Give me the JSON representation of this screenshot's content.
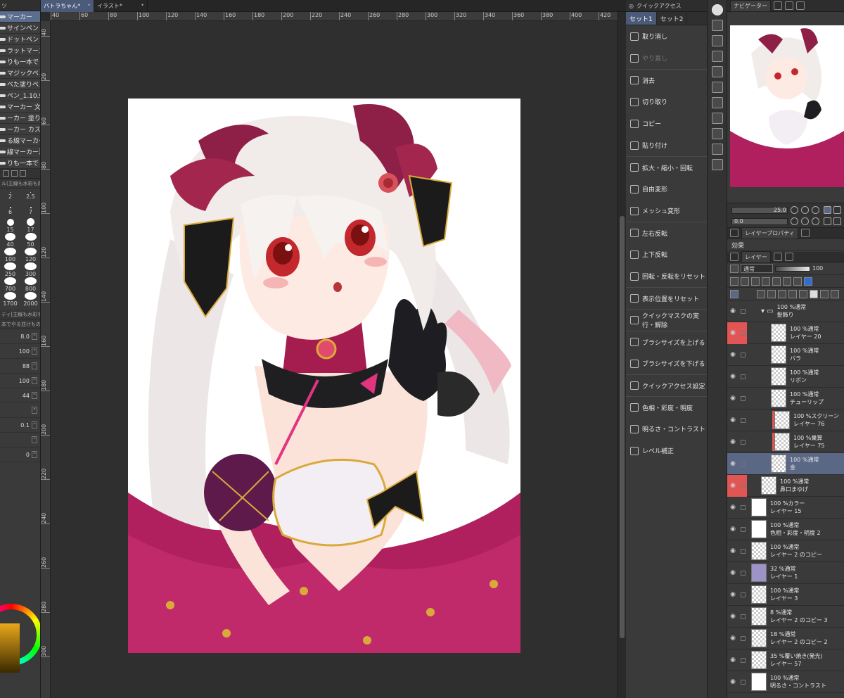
{
  "left_panel": {
    "header": "ツ",
    "subtools": [
      {
        "label": "マーカー",
        "selected": true
      },
      {
        "label": "サインペン",
        "selected": false
      },
      {
        "label": "ドットペン",
        "selected": false
      },
      {
        "label": "ラットマーカー",
        "selected": false
      },
      {
        "label": "りも一本で",
        "selected": false
      },
      {
        "label": "マジックペン",
        "selected": false
      },
      {
        "label": "べた塗りペン",
        "selected": false
      },
      {
        "label": "ペン_1.10.9",
        "selected": false
      },
      {
        "label": "マーカー 文字用",
        "selected": false
      },
      {
        "label": "ーカー 塗り用",
        "selected": false
      },
      {
        "label": "ーカー カスカス",
        "selected": false
      },
      {
        "label": "る線マーカー",
        "selected": false
      },
      {
        "label": "線マーカー濃",
        "selected": false
      },
      {
        "label": "りも一本で",
        "selected": false
      }
    ],
    "brush_section_title": "ル(主線も水彩も厚",
    "brush_sizes": [
      "2",
      "2.5",
      "6",
      "7",
      "15",
      "17",
      "40",
      "50",
      "100",
      "120",
      "250",
      "300",
      "700",
      "800",
      "1700",
      "2000"
    ],
    "tool_property_title": "ティ[主線も水彩も厚",
    "tool_property_sub": "本でやる並けものブ",
    "property_values": [
      "8.0",
      "100",
      "88",
      "100",
      "44",
      "",
      "0.1",
      "",
      "0"
    ]
  },
  "document_tabs": [
    {
      "label": "バトラちゃん*",
      "active": true
    },
    {
      "label": "イラスト*",
      "active": false
    }
  ],
  "ruler_h": [
    "40",
    "60",
    "80",
    "100",
    "120",
    "140",
    "160",
    "180",
    "200",
    "220",
    "240",
    "260",
    "280",
    "300",
    "320",
    "340",
    "360",
    "380",
    "400",
    "420"
  ],
  "ruler_v": [
    "40",
    "20",
    "60",
    "80",
    "100",
    "120",
    "140",
    "160",
    "180",
    "200",
    "220",
    "240",
    "260",
    "280",
    "300"
  ],
  "quick_access": {
    "title": "クイックアクセス",
    "tabs": [
      {
        "label": "セット1",
        "active": true
      },
      {
        "label": "セット2",
        "active": false
      }
    ],
    "items": [
      {
        "label": "取り消し",
        "icon": "undo-icon",
        "dim": false,
        "sep": false
      },
      {
        "label": "やり直し",
        "icon": "redo-icon",
        "dim": true,
        "sep": false
      },
      {
        "label": "消去",
        "icon": "clear-icon",
        "dim": false,
        "sep": true
      },
      {
        "label": "切り取り",
        "icon": "cut-icon",
        "dim": false,
        "sep": false
      },
      {
        "label": "コピー",
        "icon": "copy-icon",
        "dim": false,
        "sep": false
      },
      {
        "label": "貼り付け",
        "icon": "paste-icon",
        "dim": false,
        "sep": false
      },
      {
        "label": "拡大・縮小・回転",
        "icon": "transform-icon",
        "dim": false,
        "sep": true
      },
      {
        "label": "自由変形",
        "icon": "free-transform-icon",
        "dim": false,
        "sep": false
      },
      {
        "label": "メッシュ変形",
        "icon": "mesh-icon",
        "dim": false,
        "sep": false
      },
      {
        "label": "左右反転",
        "icon": "flip-h-icon",
        "dim": false,
        "sep": true
      },
      {
        "label": "上下反転",
        "icon": "flip-v-icon",
        "dim": false,
        "sep": false
      },
      {
        "label": "回転・反転をリセット",
        "icon": "reset-rotate-icon",
        "dim": false,
        "sep": false
      },
      {
        "label": "表示位置をリセット",
        "icon": "reset-view-icon",
        "dim": false,
        "sep": true
      },
      {
        "label": "クイックマスクの実行・解除",
        "icon": "quickmask-icon",
        "dim": false,
        "sep": true
      },
      {
        "label": "ブラシサイズを上げる",
        "icon": "brush-up-icon",
        "dim": false,
        "sep": true
      },
      {
        "label": "ブラシサイズを下げる",
        "icon": "brush-down-icon",
        "dim": false,
        "sep": false
      },
      {
        "label": "クイックアクセス設定",
        "icon": "settings-icon",
        "dim": false,
        "sep": true
      },
      {
        "label": "色相・彩度・明度",
        "icon": "hue-icon",
        "dim": false,
        "sep": true
      },
      {
        "label": "明るさ・コントラスト",
        "icon": "brightness-icon",
        "dim": false,
        "sep": false
      },
      {
        "label": "レベル補正",
        "icon": "levels-icon",
        "dim": false,
        "sep": false
      }
    ]
  },
  "navigator": {
    "title": "ナビゲーター",
    "zoom": "25.0",
    "rotation": "0.0"
  },
  "layer_property": {
    "title": "レイヤープロパティ",
    "effect_label": "効果"
  },
  "layer_panel": {
    "title": "レイヤー",
    "blend_mode": "通常",
    "opacity": "100",
    "layers": [
      {
        "meta": "100 %通常",
        "name": "髪飾り",
        "thumb": "folder",
        "red": false,
        "sel": false,
        "clip": false,
        "indent": 1
      },
      {
        "meta": "100 %通常",
        "name": "レイヤー 20",
        "thumb": "check",
        "red": true,
        "sel": false,
        "clip": false,
        "indent": 2
      },
      {
        "meta": "100 %通常",
        "name": "バラ",
        "thumb": "check",
        "red": false,
        "sel": false,
        "clip": false,
        "indent": 2
      },
      {
        "meta": "100 %通常",
        "name": "リボン",
        "thumb": "check",
        "red": false,
        "sel": false,
        "clip": false,
        "indent": 2
      },
      {
        "meta": "100 %通常",
        "name": "チューリップ",
        "thumb": "check",
        "red": false,
        "sel": false,
        "clip": false,
        "indent": 2
      },
      {
        "meta": "100 %スクリーン",
        "name": "レイヤー 76",
        "thumb": "check",
        "red": false,
        "sel": false,
        "clip": true,
        "indent": 2
      },
      {
        "meta": "100 %乗算",
        "name": "レイヤー 75",
        "thumb": "check",
        "red": false,
        "sel": false,
        "clip": true,
        "indent": 2
      },
      {
        "meta": "100 %通常",
        "name": "金",
        "thumb": "check",
        "red": false,
        "sel": true,
        "clip": false,
        "indent": 2
      },
      {
        "meta": "100 %通常",
        "name": "鼻口まゆげ",
        "thumb": "check",
        "red": true,
        "sel": false,
        "clip": false,
        "indent": 1
      },
      {
        "meta": "100 %カラー",
        "name": "レイヤー 15",
        "thumb": "white",
        "red": false,
        "sel": false,
        "clip": false,
        "indent": 0
      },
      {
        "meta": "100 %通常",
        "name": "色相・彩度・明度 2",
        "thumb": "white",
        "red": false,
        "sel": false,
        "clip": false,
        "indent": 0
      },
      {
        "meta": "100 %通常",
        "name": "レイヤー 2 のコピー",
        "thumb": "check",
        "red": false,
        "sel": false,
        "clip": false,
        "indent": 0
      },
      {
        "meta": "32 %通常",
        "name": "レイヤー 1",
        "thumb": "purple",
        "red": false,
        "sel": false,
        "clip": false,
        "indent": 0
      },
      {
        "meta": "100 %通常",
        "name": "レイヤー 3",
        "thumb": "check",
        "red": false,
        "sel": false,
        "clip": false,
        "indent": 0
      },
      {
        "meta": "8 %通常",
        "name": "レイヤー 2 のコピー 3",
        "thumb": "check",
        "red": false,
        "sel": false,
        "clip": false,
        "indent": 0
      },
      {
        "meta": "18 %通常",
        "name": "レイヤー 2 のコピー 2",
        "thumb": "check",
        "red": false,
        "sel": false,
        "clip": false,
        "indent": 0
      },
      {
        "meta": "35 %覆い焼き(発光)",
        "name": "レイヤー 57",
        "thumb": "check",
        "red": false,
        "sel": false,
        "clip": false,
        "indent": 0
      },
      {
        "meta": "100 %通常",
        "name": "明るさ・コントラスト",
        "thumb": "white",
        "red": false,
        "sel": false,
        "clip": false,
        "indent": 0
      }
    ]
  },
  "colors": {
    "accent": "#5a6785",
    "tab_active": "#4a5a78",
    "lock_red": "#e25555",
    "dress_magenta": "#b0205e",
    "hair": "#f1ece9",
    "gold": "#d9aa3a"
  }
}
